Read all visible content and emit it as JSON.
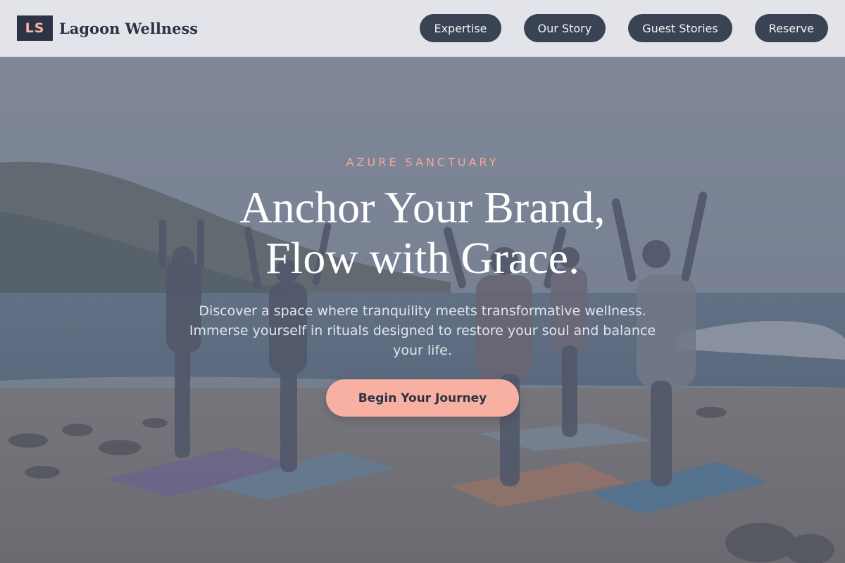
{
  "header": {
    "logo_text": "LS",
    "brand_name": "Lagoon Wellness",
    "nav": [
      {
        "label": "Expertise"
      },
      {
        "label": "Our Story"
      },
      {
        "label": "Guest Stories"
      },
      {
        "label": "Reserve"
      }
    ]
  },
  "hero": {
    "eyebrow": "AZURE SANCTUARY",
    "headline_line1": "Anchor Your Brand,",
    "headline_line2": "Flow with Grace.",
    "subtext": "Discover a space where tranquility meets transformative wellness. Immerse yourself in rituals designed to restore your soul and balance your life.",
    "cta_label": "Begin Your Journey",
    "background_image": "beach-yoga-group-photo"
  },
  "colors": {
    "header_bg": "#e2e4e9",
    "navy": "#2b3345",
    "nav_button": "#3a4354",
    "accent_peach": "#f7b0a1",
    "eyebrow": "#f3a899"
  }
}
